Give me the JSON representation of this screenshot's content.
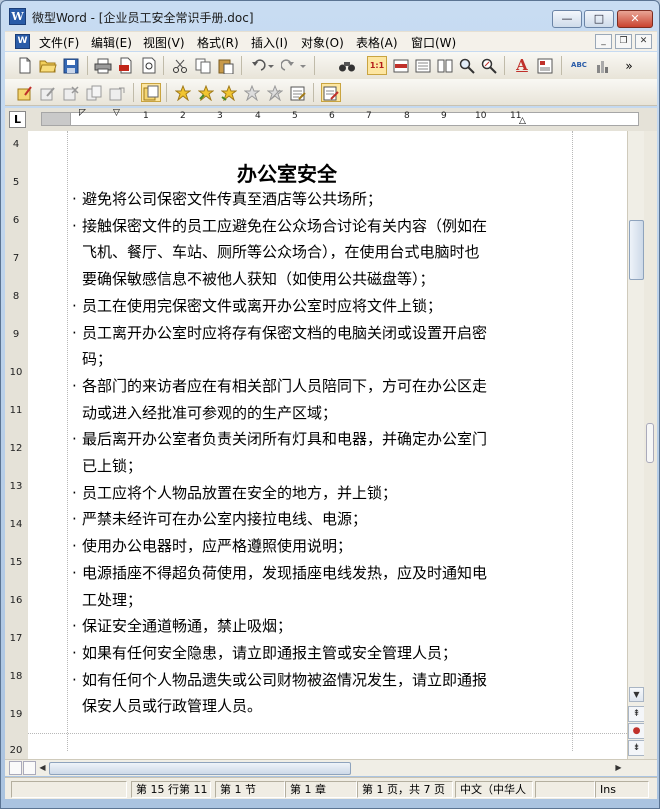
{
  "window": {
    "app_icon_letter": "W",
    "title": "微型Word - [企业员工安全常识手册.doc]",
    "buttons": {
      "min": "—",
      "max": "□",
      "close": "✕"
    }
  },
  "menubar": {
    "doc_icon_letter": "W",
    "items": [
      "文件(F)",
      "编辑(E)",
      "视图(V)",
      "格式(R)",
      "插入(I)",
      "对象(O)",
      "表格(A)",
      "窗口(W)"
    ],
    "mdi": {
      "min": "_",
      "restore": "❐",
      "close": "✕"
    }
  },
  "toolbar1": {
    "icons": [
      "new-document",
      "open-folder",
      "save",
      "print",
      "pdf-export",
      "print-preview",
      "cut",
      "copy",
      "paste",
      "undo",
      "redo",
      "find",
      "page-view-1",
      "page-view-2",
      "page-view-3",
      "page-view-4",
      "zoom-in",
      "zoom-percent",
      "text-color",
      "insert-image",
      "spell-check",
      "chart",
      "more"
    ],
    "zoom_label": "1:1",
    "text_color_letter": "A",
    "spell_label": "ABC",
    "more_label": "»"
  },
  "toolbar2": {
    "icons": [
      "open-edit",
      "edit",
      "delete",
      "copy-page",
      "move-page",
      "properties",
      "star-a",
      "star-b",
      "star-c",
      "star-d",
      "star-e",
      "notes",
      "new-note"
    ]
  },
  "ruler": {
    "corner_label": "L",
    "labels": [
      "1",
      "2",
      "3",
      "4",
      "5",
      "6",
      "7",
      "8",
      "9",
      "10",
      "11"
    ]
  },
  "vruler": {
    "labels": [
      "4",
      "5",
      "6",
      "7",
      "8",
      "9",
      "10",
      "11",
      "12",
      "13",
      "14",
      "15",
      "16",
      "17",
      "18",
      "19",
      "20"
    ]
  },
  "document": {
    "title": "办公室安全",
    "bullet": "·",
    "lines": [
      {
        "bullet": true,
        "text": "避免将公司保密文件传真至酒店等公共场所；"
      },
      {
        "bullet": true,
        "text": "接触保密文件的员工应避免在公众场合讨论有关内容（例如在"
      },
      {
        "bullet": false,
        "text": "飞机、餐厅、车站、厕所等公众场合），在使用台式电脑时也"
      },
      {
        "bullet": false,
        "text": "要确保敏感信息不被他人获知（如使用公共磁盘等）；"
      },
      {
        "bullet": true,
        "text": "员工在使用完保密文件或离开办公室时应将文件上锁；"
      },
      {
        "bullet": true,
        "text": "员工离开办公室时应将存有保密文档的电脑关闭或设置开启密"
      },
      {
        "bullet": false,
        "text": "码；"
      },
      {
        "bullet": true,
        "text": "各部门的来访者应在有相关部门人员陪同下，方可在办公区走"
      },
      {
        "bullet": false,
        "text": "动或进入经批准可参观的的生产区域；"
      },
      {
        "bullet": true,
        "text": "最后离开办公室者负责关闭所有灯具和电器，并确定办公室门"
      },
      {
        "bullet": false,
        "text": "已上锁；"
      },
      {
        "bullet": true,
        "text": "员工应将个人物品放置在安全的地方，并上锁；"
      },
      {
        "bullet": true,
        "text": "严禁未经许可在办公室内接拉电线、电源；"
      },
      {
        "bullet": true,
        "text": "使用办公电器时，应严格遵照使用说明；"
      },
      {
        "bullet": true,
        "text": "电源插座不得超负荷使用，发现插座电线发热，应及时通知电"
      },
      {
        "bullet": false,
        "text": "工处理；"
      },
      {
        "bullet": true,
        "text": "保证安全通道畅通，禁止吸烟；"
      },
      {
        "bullet": true,
        "text": "如果有任何安全隐患，请立即通报主管或安全管理人员；"
      },
      {
        "bullet": true,
        "text": "如有任何个人物品遗失或公司财物被盗情况发生，请立即通报"
      },
      {
        "bullet": false,
        "text": "保安人员或行政管理人员。"
      }
    ]
  },
  "scrollbar": {
    "up": "▲",
    "down": "▼",
    "browse_prev": "⇞",
    "browse_select": "●",
    "browse_next": "⇟",
    "left": "◀",
    "right": "▶"
  },
  "statusbar": {
    "row_col": "第 15 行第 11",
    "section": "第 1 节",
    "chapter": "第 1 章",
    "page": "第 1 页，共 7 页",
    "language": "中文（中华人",
    "mode": "Ins"
  },
  "colors": {
    "title_bar": "#b9cfe8",
    "close_button": "#c9432e",
    "menu_bg": "#f4f1ea",
    "doc_bg": "#ffffff"
  }
}
